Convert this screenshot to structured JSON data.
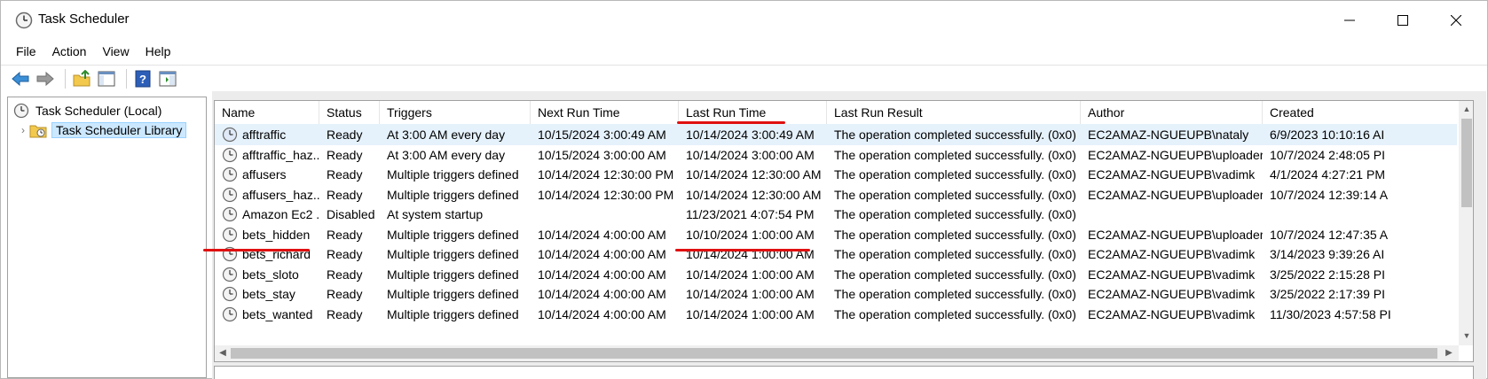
{
  "window": {
    "title": "Task Scheduler"
  },
  "menu": [
    "File",
    "Action",
    "View",
    "Help"
  ],
  "toolbar": {
    "icons": [
      "back-arrow-icon",
      "forward-arrow-icon",
      "folder-up-icon",
      "show-hide-console-tree-icon",
      "help-icon",
      "show-hide-action-pane-icon"
    ]
  },
  "tree": {
    "root": "Task Scheduler (Local)",
    "child": "Task Scheduler Library"
  },
  "table": {
    "columns": [
      "Name",
      "Status",
      "Triggers",
      "Next Run Time",
      "Last Run Time",
      "Last Run Result",
      "Author",
      "Created"
    ],
    "rows": [
      [
        "afftraffic",
        "Ready",
        "At 3:00 AM every day",
        "10/15/2024 3:00:49 AM",
        "10/14/2024 3:00:49 AM",
        "The operation completed successfully. (0x0)",
        "EC2AMAZ-NGUEUPB\\nataly",
        "6/9/2023 10:10:16 AI"
      ],
      [
        "afftraffic_haz...",
        "Ready",
        "At 3:00 AM every day",
        "10/15/2024 3:00:00 AM",
        "10/14/2024 3:00:00 AM",
        "The operation completed successfully. (0x0)",
        "EC2AMAZ-NGUEUPB\\uploader",
        "10/7/2024 2:48:05 PI"
      ],
      [
        "affusers",
        "Ready",
        "Multiple triggers defined",
        "10/14/2024 12:30:00 PM",
        "10/14/2024 12:30:00 AM",
        "The operation completed successfully. (0x0)",
        "EC2AMAZ-NGUEUPB\\vadimk",
        "4/1/2024 4:27:21 PM"
      ],
      [
        "affusers_haz...",
        "Ready",
        "Multiple triggers defined",
        "10/14/2024 12:30:00 PM",
        "10/14/2024 12:30:00 AM",
        "The operation completed successfully. (0x0)",
        "EC2AMAZ-NGUEUPB\\uploader",
        "10/7/2024 12:39:14 A"
      ],
      [
        "Amazon Ec2 ...",
        "Disabled",
        "At system startup",
        "",
        "11/23/2021 4:07:54 PM",
        "The operation completed successfully. (0x0)",
        "",
        ""
      ],
      [
        "bets_hidden",
        "Ready",
        "Multiple triggers defined",
        "10/14/2024 4:00:00 AM",
        "10/10/2024 1:00:00 AM",
        "The operation completed successfully. (0x0)",
        "EC2AMAZ-NGUEUPB\\uploader",
        "10/7/2024 12:47:35 A"
      ],
      [
        "bets_richard",
        "Ready",
        "Multiple triggers defined",
        "10/14/2024 4:00:00 AM",
        "10/14/2024 1:00:00 AM",
        "The operation completed successfully. (0x0)",
        "EC2AMAZ-NGUEUPB\\vadimk",
        "3/14/2023 9:39:26 AI"
      ],
      [
        "bets_sloto",
        "Ready",
        "Multiple triggers defined",
        "10/14/2024 4:00:00 AM",
        "10/14/2024 1:00:00 AM",
        "The operation completed successfully. (0x0)",
        "EC2AMAZ-NGUEUPB\\vadimk",
        "3/25/2022 2:15:28 PI"
      ],
      [
        "bets_stay",
        "Ready",
        "Multiple triggers defined",
        "10/14/2024 4:00:00 AM",
        "10/14/2024 1:00:00 AM",
        "The operation completed successfully. (0x0)",
        "EC2AMAZ-NGUEUPB\\vadimk",
        "3/25/2022 2:17:39 PI"
      ],
      [
        "bets_wanted",
        "Ready",
        "Multiple triggers defined",
        "10/14/2024 4:00:00 AM",
        "10/14/2024 1:00:00 AM",
        "The operation completed successfully. (0x0)",
        "EC2AMAZ-NGUEUPB\\vadimk",
        "11/30/2023 4:57:58 PI"
      ]
    ],
    "selected_row": 0
  },
  "colors": {
    "annotation": "#e01010",
    "selection": "#e5f1fb"
  }
}
